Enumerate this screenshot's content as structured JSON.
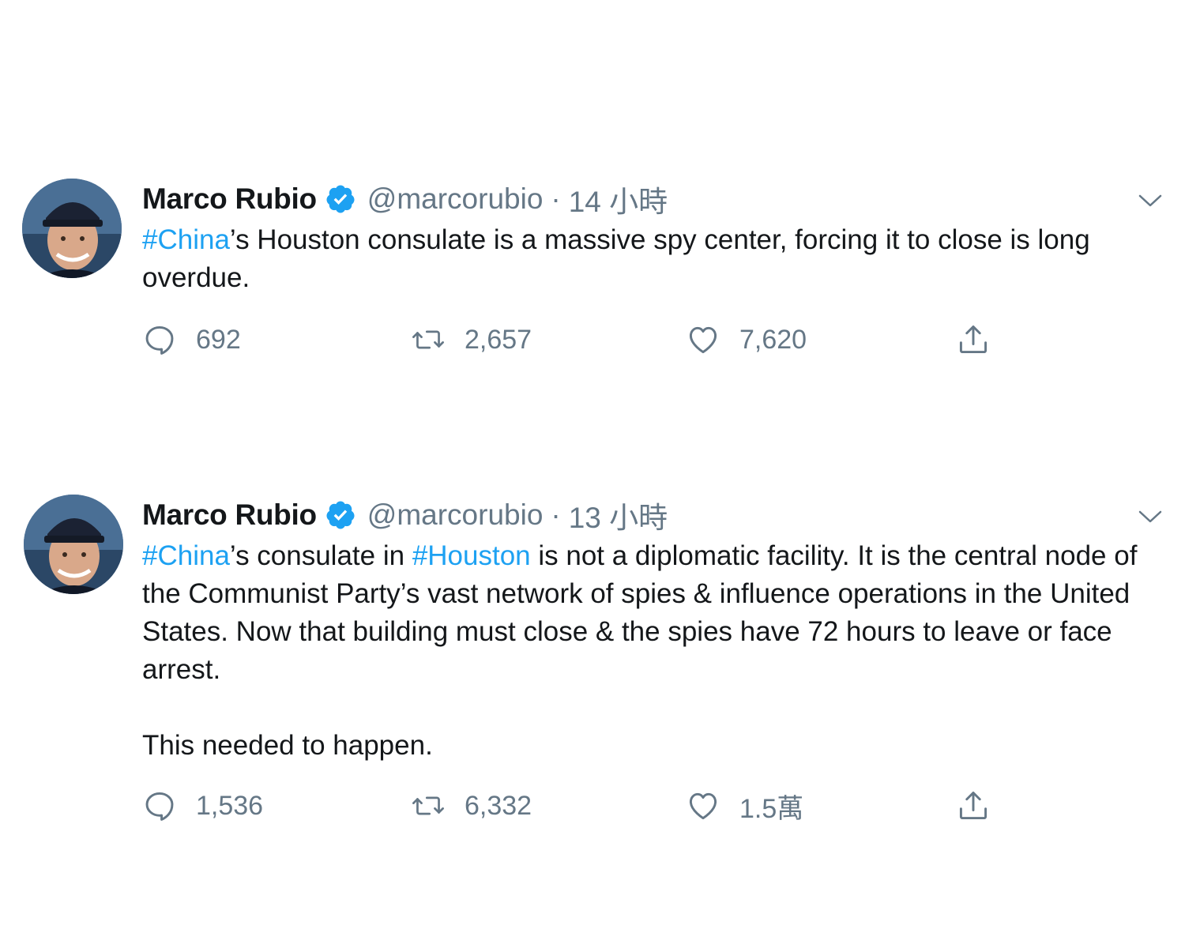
{
  "tweets": [
    {
      "author": {
        "name": "Marco Rubio",
        "handle": "@marcorubio",
        "verified": true,
        "avatar_icon": "profile-photo"
      },
      "separator": "·",
      "time": "14 小時",
      "text": {
        "hashtag1": "#China",
        "rest1": "’s Houston consulate is a massive spy center, forcing it to close is long overdue."
      },
      "stats": {
        "replies": "692",
        "retweets": "2,657",
        "likes": "7,620"
      }
    },
    {
      "author": {
        "name": "Marco Rubio",
        "handle": "@marcorubio",
        "verified": true,
        "avatar_icon": "profile-photo"
      },
      "separator": "·",
      "time": "13 小時",
      "text": {
        "hashtag1": "#China",
        "mid1": "’s consulate in ",
        "hashtag2": "#Houston",
        "rest1": " is not a diplomatic facility. It is the central node of the Communist Party’s vast network of spies & influence operations in the United States. Now that building must close & the spies have 72 hours to leave or face arrest.",
        "para2": "This needed to happen."
      },
      "stats": {
        "replies": "1,536",
        "retweets": "6,332",
        "likes": "1.5萬"
      }
    }
  ],
  "colors": {
    "text": "#14171a",
    "secondary": "#657786",
    "link": "#1da1f2",
    "verified": "#1da1f2"
  }
}
